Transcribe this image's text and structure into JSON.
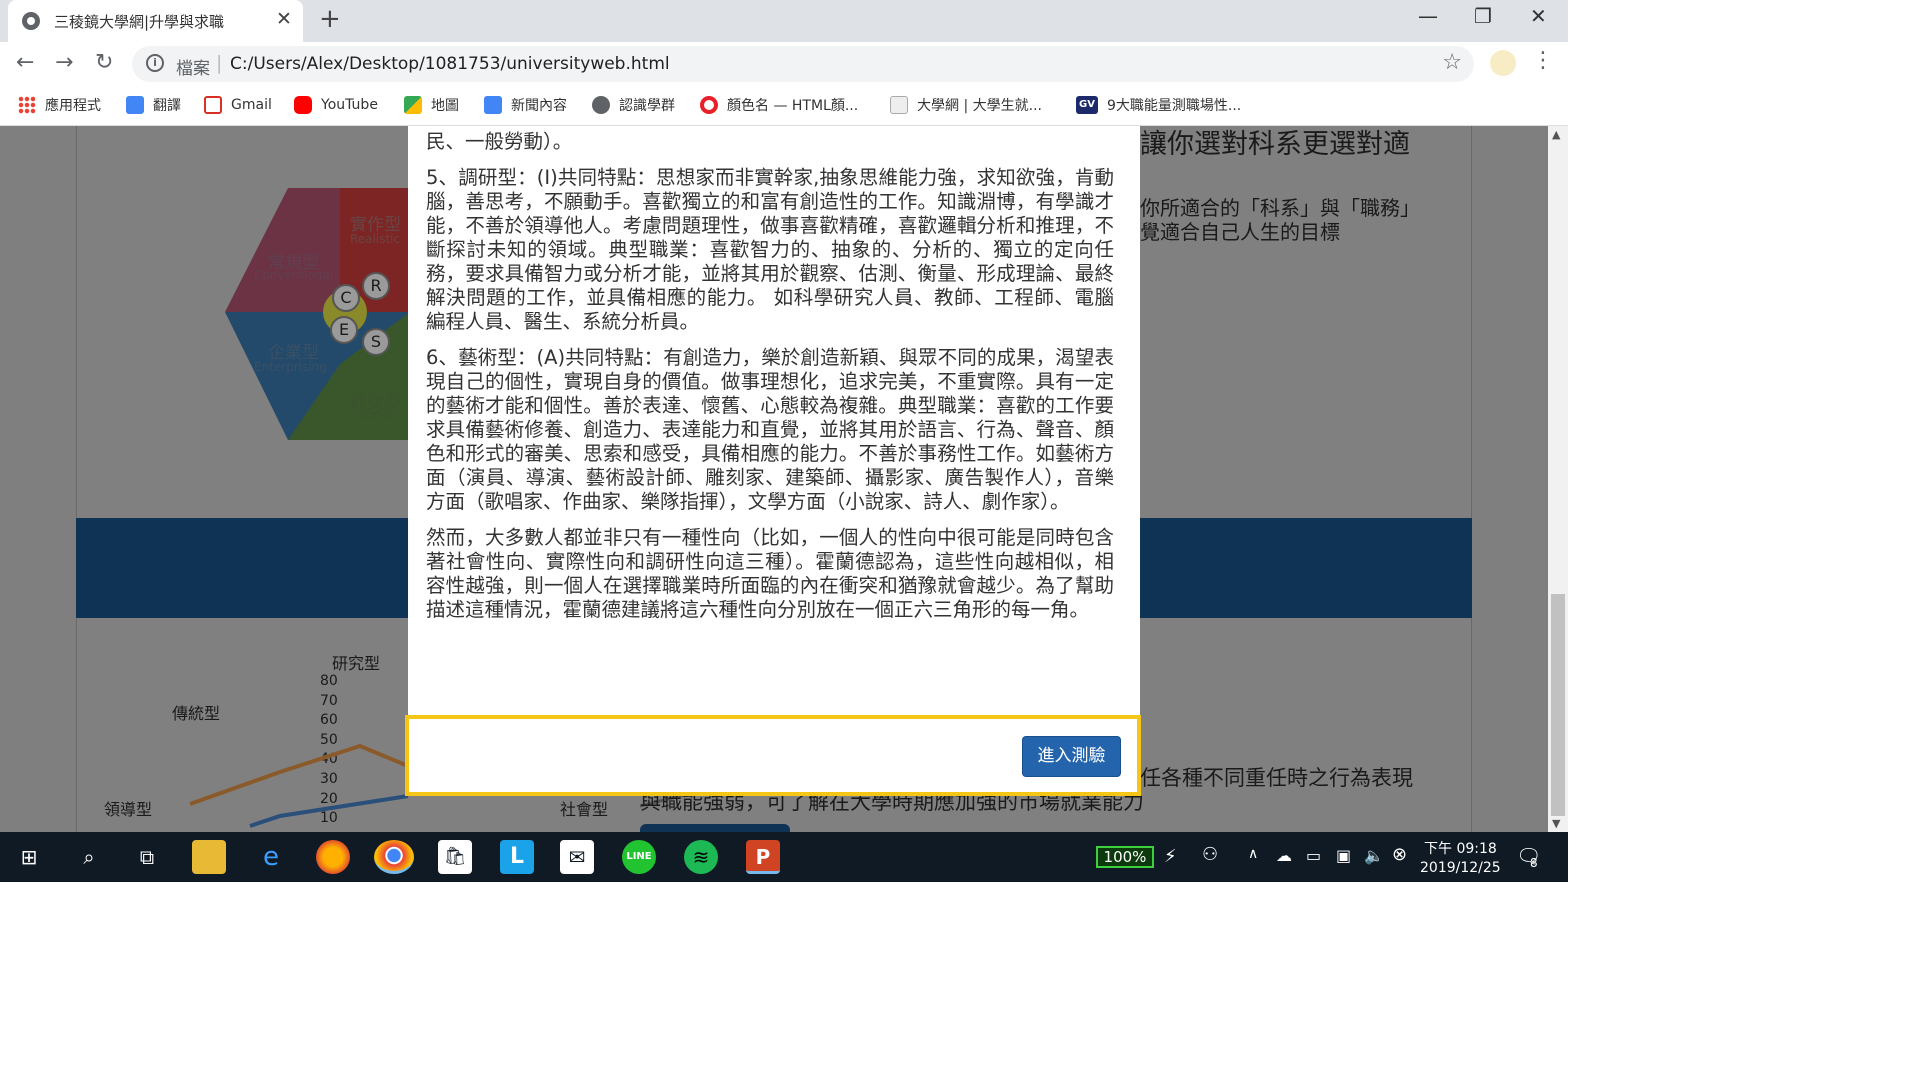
{
  "browser": {
    "tab_title": "三稜鏡大學網|升學與求職",
    "tab_close": "✕",
    "new_tab": "+",
    "window_controls": {
      "minimize": "—",
      "restore": "❐",
      "close": "✕"
    },
    "nav": {
      "back": "←",
      "forward": "→",
      "reload": "↻"
    },
    "address": {
      "scheme_label": "檔案",
      "url": "C:/Users/Alex/Desktop/1081753/universityweb.html"
    },
    "bookmarks": [
      {
        "label": "應用程式",
        "icon": "apps-grid-icon",
        "color": "#4285f4"
      },
      {
        "label": "翻譯",
        "icon": "translate-icon",
        "color": "#4285f4"
      },
      {
        "label": "Gmail",
        "icon": "gmail-icon",
        "color": "#d93025"
      },
      {
        "label": "YouTube",
        "icon": "youtube-icon",
        "color": "#ff0000"
      },
      {
        "label": "地圖",
        "icon": "maps-icon",
        "color": "#34a853"
      },
      {
        "label": "新聞內容",
        "icon": "news-icon",
        "color": "#4285f4"
      },
      {
        "label": "認識學群",
        "icon": "globe-icon",
        "color": "#5f6368"
      },
      {
        "label": "顏色名 — HTML顏...",
        "icon": "opera-icon",
        "color": "#e8202a"
      },
      {
        "label": "大學網 | 大學生就...",
        "icon": "page-icon",
        "color": "#9e9e9e"
      },
      {
        "label": "9大職能量測職場性...",
        "icon": "gv-icon",
        "color": "#1c2a6b"
      }
    ]
  },
  "background": {
    "hexagon": {
      "realistic_zh": "實作型",
      "realistic_en": "Realistic",
      "conventional_zh": "常規型",
      "conventional_en": "Conventional",
      "enterprising_zh": "企業型",
      "enterprising_en": "Enterprising",
      "social_zh": "社交型",
      "social_en": "Social",
      "letters": [
        "C",
        "R",
        "E",
        "S"
      ]
    },
    "right_heading": "讓你選對科系更選對適",
    "right_text_1": "你所適合的「科系」與「職務」",
    "right_text_2": "覺適合自己人生的目標",
    "radar": {
      "axis_top": "研究型",
      "axis_left_top": "傳統型",
      "axis_left_bottom": "領導型",
      "axis_bottom_right": "社會型",
      "ticks": [
        "80",
        "70",
        "60",
        "50",
        "40",
        "30",
        "20",
        "10"
      ]
    },
    "lower_text_1": "任各種不同重任時之行為表現",
    "lower_text_2": "與職能強弱，可了解在大學時期應加強的市場就業能力"
  },
  "modal": {
    "paragraph_0": "民、一般勞動）。",
    "paragraph_5": "5、調研型：(I)共同特點：思想家而非實幹家,抽象思維能力強，求知欲強，肯動腦，善思考，不願動手。喜歡獨立的和富有創造性的工作。知識淵博，有學識才能，不善於領導他人。考慮問題理性，做事喜歡精確，喜歡邏輯分析和推理，不斷探討未知的領域。典型職業：喜歡智力的、抽象的、分析的、獨立的定向任務，要求具備智力或分析才能，並將其用於觀察、估測、衡量、形成理論、最終解決問題的工作，並具備相應的能力。 如科學研究人員、教師、工程師、電腦編程人員、醫生、系統分析員。",
    "paragraph_6": "6、藝術型：(A)共同特點：有創造力，樂於創造新穎、與眾不同的成果，渴望表現自己的個性，實現自身的價值。做事理想化，追求完美，不重實際。具有一定的藝術才能和個性。善於表達、懷舊、心態較為複雜。典型職業：喜歡的工作要求具備藝術修養、創造力、表達能力和直覺，並將其用於語言、行為、聲音、顏色和形式的審美、思索和感受，具備相應的能力。不善於事務性工作。如藝術方面（演員、導演、藝術設計師、雕刻家、建築師、攝影家、廣告製作人），音樂方面（歌唱家、作曲家、樂隊指揮），文學方面（小說家、詩人、劇作家）。",
    "paragraph_conclusion": "然而，大多數人都並非只有一種性向（比如，一個人的性向中很可能是同時包含著社會性向、實際性向和調研性向這三種）。霍蘭德認為，這些性向越相似，相容性越強，則一個人在選擇職業時所面臨的內在衝突和猶豫就會越少。為了幫助描述這種情況，霍蘭德建議將這六種性向分別放在一個正六三角形的每一角。",
    "enter_button": "進入測驗",
    "highlight_color": "#f5c518"
  },
  "taskbar": {
    "battery": "100%",
    "time": "下午 09:18",
    "date": "2019/12/25",
    "notifications": "8",
    "apps": [
      "windows-start-icon",
      "search-icon",
      "task-view-icon",
      "file-explorer-icon",
      "edge-icon",
      "firefox-icon",
      "chrome-icon",
      "store-icon",
      "line-l-icon",
      "mail-icon",
      "line-icon",
      "spotify-icon",
      "powerpoint-icon"
    ]
  }
}
